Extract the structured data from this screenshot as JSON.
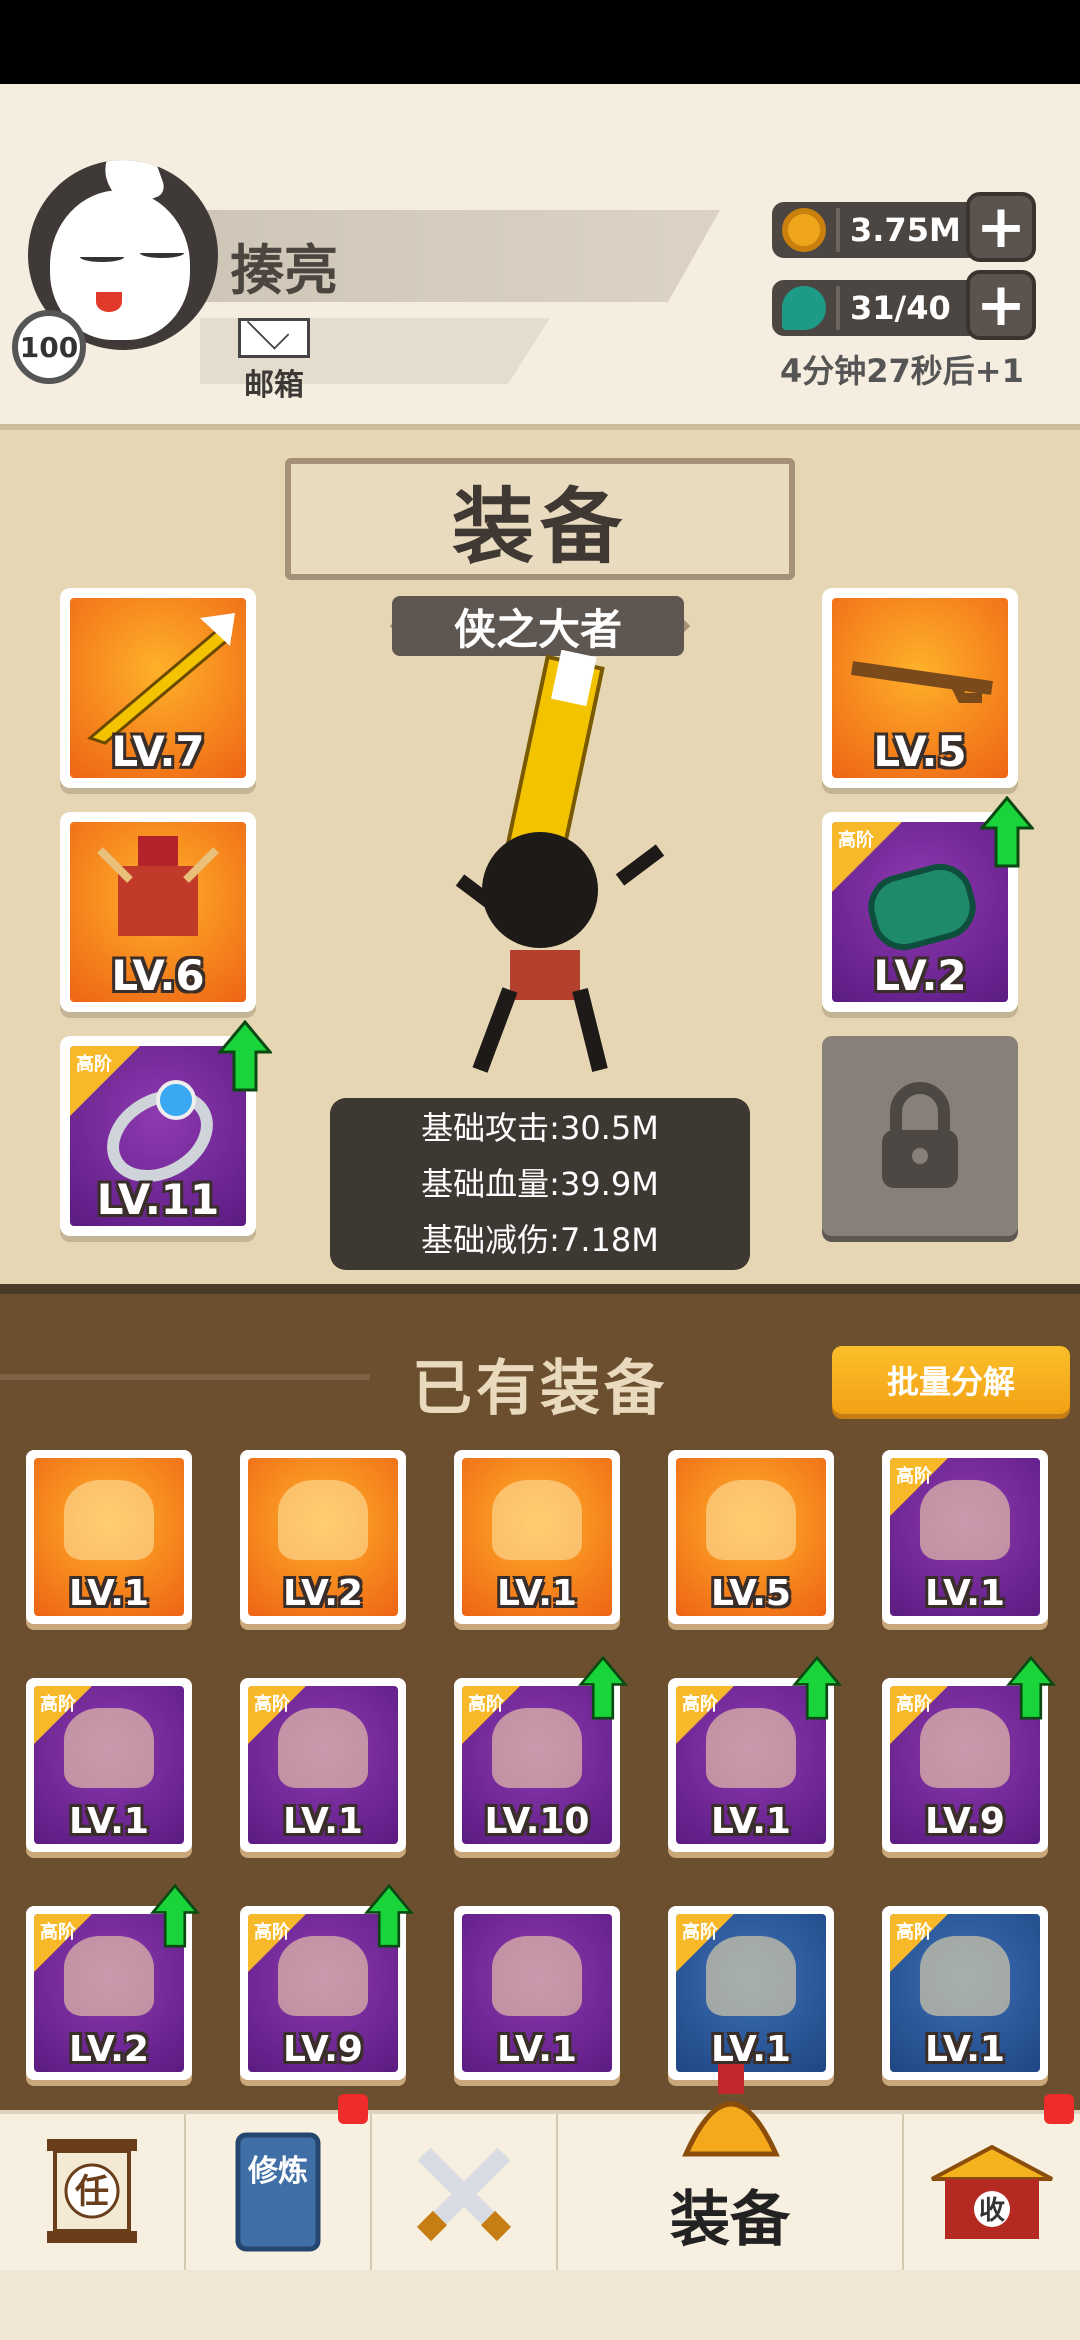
{
  "player": {
    "name": "揍亮",
    "level": "100",
    "mail_label": "邮箱"
  },
  "currency": {
    "gold": "3.75M",
    "energy": "31/40",
    "timer": "4分钟27秒后+1"
  },
  "equipment": {
    "title": "装备",
    "subtitle": "侠之大者",
    "slots": [
      {
        "level": "LV.7",
        "tier": "",
        "upgrade": false,
        "bg": "orange"
      },
      {
        "level": "LV.6",
        "tier": "",
        "upgrade": false,
        "bg": "orange"
      },
      {
        "level": "LV.11",
        "tier": "高阶",
        "upgrade": true,
        "bg": "purple"
      },
      {
        "level": "LV.5",
        "tier": "",
        "upgrade": false,
        "bg": "orange"
      },
      {
        "level": "LV.2",
        "tier": "高阶",
        "upgrade": true,
        "bg": "purple"
      }
    ],
    "stats": [
      "基础攻击:30.5M",
      "基础血量:39.9M",
      "基础减伤:7.18M"
    ]
  },
  "owned": {
    "title": "已有装备",
    "batch_label": "批量分解",
    "items": [
      {
        "level": "LV.1",
        "tier": "",
        "upgrade": false,
        "bg": "orange"
      },
      {
        "level": "LV.2",
        "tier": "",
        "upgrade": false,
        "bg": "orange"
      },
      {
        "level": "LV.1",
        "tier": "",
        "upgrade": false,
        "bg": "orange"
      },
      {
        "level": "LV.5",
        "tier": "",
        "upgrade": false,
        "bg": "orange"
      },
      {
        "level": "LV.1",
        "tier": "高阶",
        "upgrade": false,
        "bg": "purple"
      },
      {
        "level": "LV.1",
        "tier": "高阶",
        "upgrade": false,
        "bg": "purple"
      },
      {
        "level": "LV.1",
        "tier": "高阶",
        "upgrade": false,
        "bg": "purple"
      },
      {
        "level": "LV.10",
        "tier": "高阶",
        "upgrade": true,
        "bg": "purple"
      },
      {
        "level": "LV.1",
        "tier": "高阶",
        "upgrade": true,
        "bg": "purple"
      },
      {
        "level": "LV.9",
        "tier": "高阶",
        "upgrade": true,
        "bg": "purple"
      },
      {
        "level": "LV.2",
        "tier": "高阶",
        "upgrade": true,
        "bg": "purple"
      },
      {
        "level": "LV.9",
        "tier": "高阶",
        "upgrade": true,
        "bg": "purple"
      },
      {
        "level": "LV.1",
        "tier": "",
        "upgrade": false,
        "bg": "purple"
      },
      {
        "level": "LV.1",
        "tier": "高阶",
        "upgrade": false,
        "bg": "blue"
      },
      {
        "level": "LV.1",
        "tier": "高阶",
        "upgrade": false,
        "bg": "blue"
      }
    ]
  },
  "nav": {
    "task_label": "任",
    "cultivate_label": "修炼",
    "equip_label": "装备",
    "shop_label": "收"
  }
}
